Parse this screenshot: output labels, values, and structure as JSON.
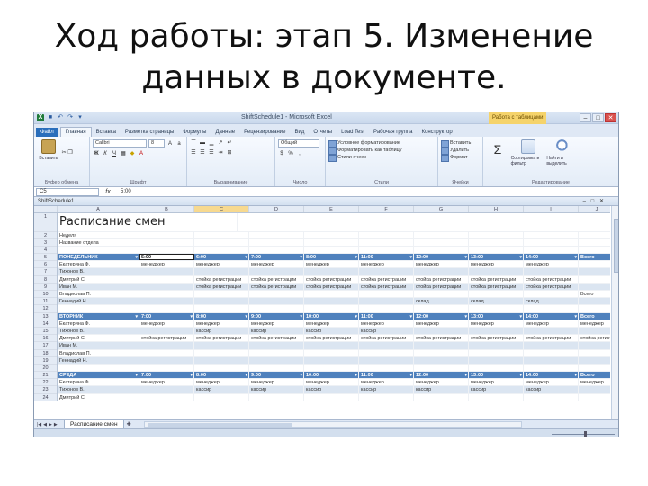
{
  "slide": {
    "title_line1": "Ход работы: этап 5. Изменение",
    "title_line2": "данных в документе."
  },
  "window": {
    "title": "ShiftSchedule1 - Microsoft Excel",
    "contextual_tab": "Работа с таблицами"
  },
  "ribbon": {
    "tabs": [
      "Файл",
      "Главная",
      "Вставка",
      "Разметка страницы",
      "Формулы",
      "Данные",
      "Рецензирование",
      "Вид",
      "Отчеты",
      "Load Test",
      "Рабочая группа",
      "Конструктор"
    ],
    "paste_label": "Вставить",
    "font_name": "Calibri",
    "font_size": "8",
    "groups": {
      "clipboard": "Буфер обмена",
      "font": "Шрифт",
      "alignment": "Выравнивание",
      "number": "Число",
      "styles": "Стили",
      "cells": "Ячейки",
      "editing": "Редактирование"
    },
    "number_format": "Общий",
    "styles_items": [
      "Условное форматирование",
      "Форматировать как таблицу",
      "Стили ячеек"
    ],
    "cells_items": [
      "Вставить",
      "Удалить",
      "Формат"
    ],
    "sort_label": "Сортировка и фильтр",
    "find_label": "Найти и выделить"
  },
  "formula_bar": {
    "name_box": "C5",
    "fx": "fx",
    "value": "5:00"
  },
  "workbook": {
    "doc_title": "ShiftSchedule1",
    "sheet_tab": "Расписание смен",
    "col_headers": [
      "A",
      "B",
      "C",
      "D",
      "E",
      "F",
      "G",
      "H",
      "I",
      "J",
      "K"
    ],
    "row_headers": [
      "1",
      "2",
      "3",
      "4",
      "5",
      "6",
      "7",
      "8",
      "9",
      "10",
      "11",
      "12",
      "13",
      "14",
      "15",
      "16",
      "17",
      "18",
      "19",
      "20",
      "21",
      "22",
      "23",
      "24"
    ],
    "sheet_title": "Расписание смен",
    "rows": [
      [
        ""
      ],
      [
        "Неделя"
      ],
      [
        "Название отдела"
      ],
      [
        ""
      ],
      [
        "ПОНЕДЕЛЬНИК",
        "5:00",
        "6:00",
        "7:00",
        "8:00",
        "11:00",
        "12:00",
        "13:00",
        "14:00",
        "15:00",
        "Всего"
      ],
      [
        "Екатерина Ф.",
        "менеджер",
        "менеджер",
        "менеджер",
        "менеджер",
        "менеджер",
        "менеджер",
        "менеджер",
        "менеджер",
        "",
        ""
      ],
      [
        "Тихонов В.",
        "",
        "",
        "",
        "",
        "",
        "",
        "",
        "",
        "",
        ""
      ],
      [
        "Дмитрий С.",
        "",
        "стойка регистрации",
        "стойка регистрации",
        "стойка регистрации",
        "стойка регистрации",
        "стойка регистрации",
        "стойка регистрации",
        "стойка регистрации",
        "",
        ""
      ],
      [
        "Иван М.",
        "",
        "стойка регистрации",
        "стойка регистрации",
        "стойка регистрации",
        "стойка регистрации",
        "стойка регистрации",
        "стойка регистрации",
        "стойка регистрации",
        "",
        ""
      ],
      [
        "Владислав П.",
        "",
        "",
        "",
        "",
        "",
        "",
        "",
        "",
        "",
        "Всего"
      ],
      [
        "Геннадий Н.",
        "",
        "",
        "",
        "",
        "",
        "склад",
        "склад",
        "склад",
        "",
        ""
      ],
      [
        ""
      ],
      [
        "ВТОРНИК",
        "7:00",
        "8:00",
        "9:00",
        "10:00",
        "11:00",
        "12:00",
        "13:00",
        "14:00",
        "15:00",
        "Всего"
      ],
      [
        "Екатерина Ф.",
        "менеджер",
        "менеджер",
        "менеджер",
        "менеджер",
        "менеджер",
        "менеджер",
        "менеджер",
        "менеджер",
        "менеджер",
        ""
      ],
      [
        "Тихонов В.",
        "",
        "кассир",
        "кассир",
        "кассир",
        "кассир",
        "",
        "",
        "",
        "",
        ""
      ],
      [
        "Дмитрий С.",
        "стойка регистрации",
        "стойка регистрации",
        "стойка регистрации",
        "стойка регистрации",
        "стойка регистрации",
        "стойка регистрации",
        "стойка регистрации",
        "стойка регистрации",
        "стойка регистрации",
        ""
      ],
      [
        "Иван М.",
        "",
        "",
        "",
        "",
        "",
        "",
        "",
        "",
        "",
        ""
      ],
      [
        "Владислав П.",
        "",
        "",
        "",
        "",
        "",
        "",
        "",
        "",
        "",
        ""
      ],
      [
        "Геннадий Н.",
        "",
        "",
        "",
        "",
        "",
        "",
        "",
        "",
        "",
        ""
      ],
      [
        ""
      ],
      [
        "СРЕДА",
        "7:00",
        "8:00",
        "9:00",
        "10:00",
        "11:00",
        "12:00",
        "13:00",
        "14:00",
        "15:00",
        "Всего"
      ],
      [
        "Екатерина Ф.",
        "менеджер",
        "менеджер",
        "менеджер",
        "менеджер",
        "менеджер",
        "менеджер",
        "менеджер",
        "менеджер",
        "менеджер",
        ""
      ],
      [
        "Тихонов В.",
        "",
        "кассир",
        "кассир",
        "кассир",
        "кассир",
        "кассир",
        "кассир",
        "кассир",
        "",
        ""
      ],
      [
        "Дмитрий С.",
        "",
        "",
        "",
        "",
        "",
        "",
        "",
        "",
        "",
        ""
      ]
    ]
  },
  "colors": {
    "header_fill": "#4f81bd",
    "band_fill": "#dbe5f1",
    "file_tab": "#2a6ebb",
    "context_tab": "#f5d36b"
  }
}
